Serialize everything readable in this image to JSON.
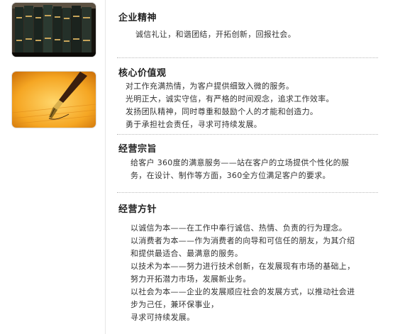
{
  "sections": [
    {
      "title": "企业精神",
      "lines": [
        "诚信礼让，和谐团结，开拓创新，回报社会。"
      ]
    },
    {
      "title": "核心价值观",
      "lines": [
        "对工作充满热情，为客户提供细致入微的服务。",
        "光明正大，诚实守信，有严格的时间观念，追求工作效率。",
        "发扬团队精神，同时尊重和鼓励个人的才能和创造力。",
        "勇于承担社会责任，寻求可持续发展。"
      ]
    },
    {
      "title": "经营宗旨",
      "lines": [
        "给客户  360度的满意服务——站在客户的立场提供个性化的服",
        "务，在设计、制作等方面，360全方位满足客户的要求。"
      ]
    },
    {
      "title": "经营方针",
      "lines": [
        "以诚信为本——在工作中奉行诚信、热情、负责的行为理念。",
        "以消费者为本——作为消费者的向导和可信任的朋友，为其介绍",
        "和提供最适合、最满意的服务。",
        "以技术为本——努力进行技术创新，在发展现有市场的基础上，",
        "努力开拓潜力市场，发展新业务。",
        "以社会为本——企业的发展顺应社会的发展方式，以推动社会进",
        "步为己任，兼环保事业，",
        "寻求可持续发展。"
      ]
    }
  ],
  "images": [
    {
      "icon": "bookshelf-image"
    },
    {
      "icon": "fountain-pen-image"
    }
  ],
  "colors": {
    "title": "#222222",
    "text": "#333333",
    "divider": "#bbbbbb",
    "pen_bg": "#f5a623",
    "books_bg": "#1d1a14"
  }
}
